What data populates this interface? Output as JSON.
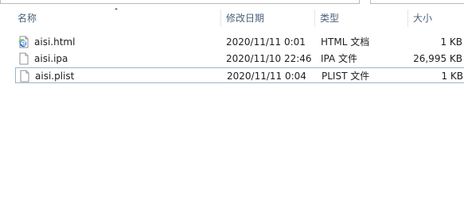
{
  "columns": {
    "name": "名称",
    "date": "修改日期",
    "type": "类型",
    "size": "大小"
  },
  "files": [
    {
      "name": "aisi.html",
      "date": "2020/11/11 0:01",
      "type": "HTML 文档",
      "size": "1 KB",
      "icon": "edge-html-icon"
    },
    {
      "name": "aisi.ipa",
      "date": "2020/11/10 22:46",
      "type": "IPA 文件",
      "size": "26,995 KB",
      "icon": "blank-file-icon"
    },
    {
      "name": "aisi.plist",
      "date": "2020/11/11 0:04",
      "type": "PLIST 文件",
      "size": "1 KB",
      "icon": "blank-file-icon"
    }
  ]
}
